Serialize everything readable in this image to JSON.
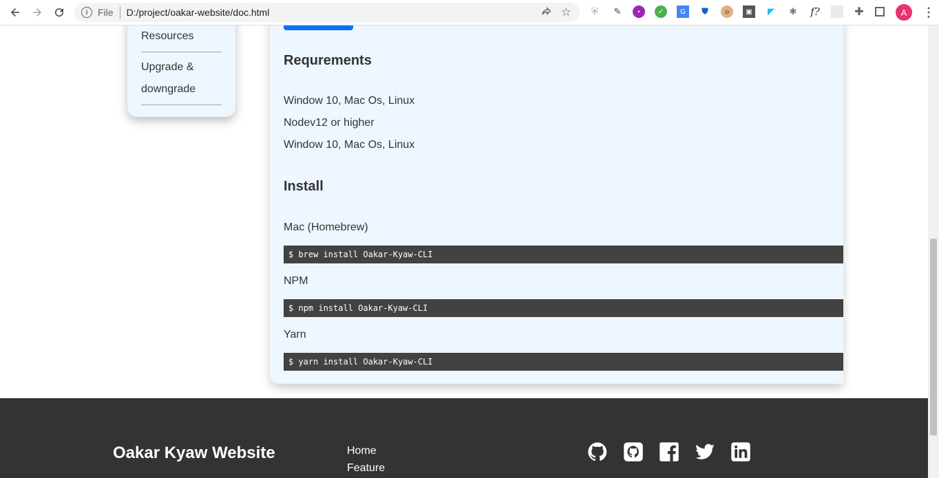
{
  "browser": {
    "scheme": "File",
    "url": "D:/project/oakar-website/doc.html",
    "profile_initial": "A"
  },
  "sidebar": {
    "items": [
      "Resources",
      "Upgrade &",
      "downgrade"
    ]
  },
  "content": {
    "requirements_heading": "Requrements",
    "requirements": [
      "Window 10, Mac Os, Linux",
      "Nodev12 or higher",
      "Window 10, Mac Os, Linux"
    ],
    "install_heading": "Install",
    "install": [
      {
        "label": "Mac (Homebrew)",
        "command": "$ brew install Oakar-Kyaw-CLI"
      },
      {
        "label": "NPM",
        "command": "$ npm install Oakar-Kyaw-CLI"
      },
      {
        "label": "Yarn",
        "command": "$ yarn install Oakar-Kyaw-CLI"
      }
    ]
  },
  "footer": {
    "title": "Oakar Kyaw Website",
    "links": [
      "Home",
      "Feature"
    ],
    "social_icons": [
      "github-icon",
      "github-square-icon",
      "facebook-icon",
      "twitter-icon",
      "linkedin-icon"
    ]
  }
}
